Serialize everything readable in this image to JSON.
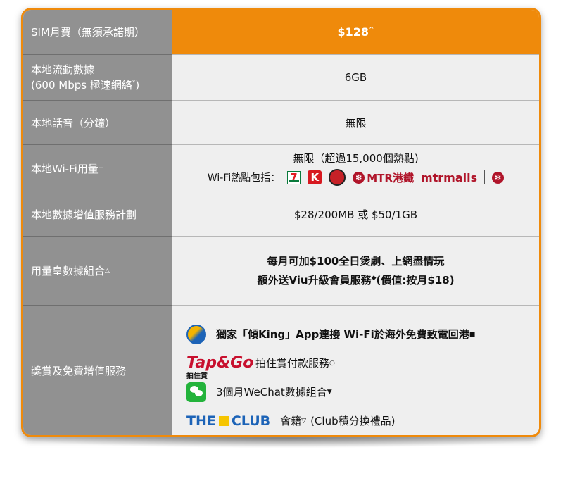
{
  "rows": [
    {
      "label": "SIM月費（無須承諾期）",
      "value": "$128",
      "value_sup": "^"
    },
    {
      "label_line1": "本地流動數據",
      "label_line2": "(600  Mbps 極速網絡",
      "label_line2_sup": "*",
      "label_line2_end": ")",
      "value": "6GB"
    },
    {
      "label": "本地話音（分鐘）",
      "value": "無限"
    },
    {
      "label": "本地Wi-Fi用量",
      "label_sup": "+",
      "value_line1": "無限（超過15,000個熱點)",
      "value_line2_prefix": "Wi-Fi熱點包括：",
      "brands": {
        "seven": "7",
        "circle_k": "K",
        "mtr": "MTR港鐵",
        "mtrmalls": "mtrmalls"
      }
    },
    {
      "label": "本地數據增值服務計劃",
      "value": "$28/200MB 或 $50/1GB"
    },
    {
      "label": "用量皇數據組合",
      "label_sup": "△",
      "value_line1": "每月可加$100全日煲劇、上網盡情玩",
      "value_line2": "額外送Viu升級會員服務",
      "value_line2_sup": "◆",
      "value_line2_end": "(價值:按月$18)"
    },
    {
      "label": "獎賞及免費增值服務",
      "perks": [
        {
          "icon": "king-ball-icon",
          "text": "獨家「傾King」App連接 Wi-Fi於海外免費致電回港",
          "sup": "■"
        },
        {
          "icon": "tapgo-logo",
          "logo_text": "Tap&Go",
          "logo_sub": "拍住賞",
          "text": "拍住賞付款服務",
          "sup": "○"
        },
        {
          "icon": "wechat-icon",
          "text": "3個月WeChat數據組合",
          "sup": "▼"
        },
        {
          "icon": "the-club-logo",
          "logo_text_1": "THE",
          "logo_text_2": "CLUB",
          "text": "會籍",
          "sup": "▽",
          "text_end": "(Club積分換禮品)"
        }
      ]
    }
  ],
  "colors": {
    "accent": "#ef8a0b",
    "label_bg": "#919191",
    "cell_bg": "#efefef"
  }
}
